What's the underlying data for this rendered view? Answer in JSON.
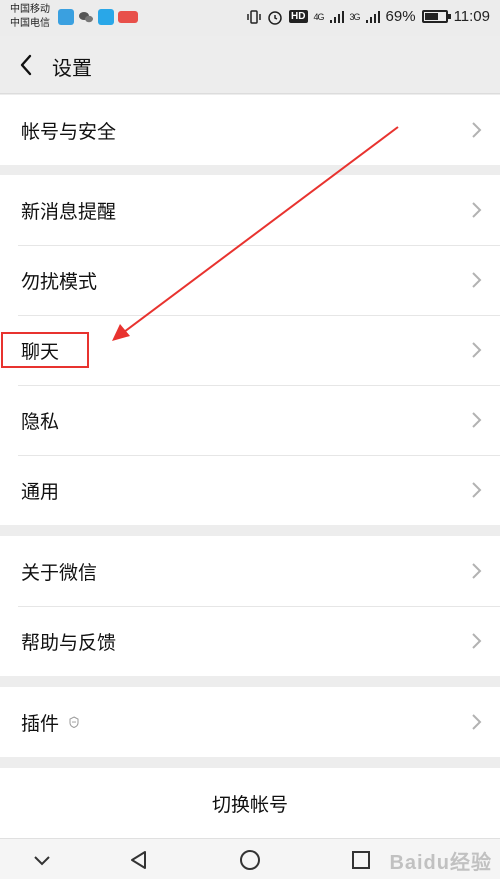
{
  "status_bar": {
    "carrier1": "中国移动",
    "carrier2": "中国电信",
    "net1": "4G",
    "net2": "3G",
    "battery_text": "69%",
    "battery_level": 0.69,
    "time": "11:09",
    "hd": "HD"
  },
  "header": {
    "title": "设置"
  },
  "groups": [
    {
      "items": [
        {
          "label": "帐号与安全"
        }
      ]
    },
    {
      "items": [
        {
          "label": "新消息提醒"
        },
        {
          "label": "勿扰模式"
        },
        {
          "label": "聊天"
        },
        {
          "label": "隐私"
        },
        {
          "label": "通用"
        }
      ]
    },
    {
      "items": [
        {
          "label": "关于微信"
        },
        {
          "label": "帮助与反馈"
        }
      ]
    },
    {
      "items": [
        {
          "label": "插件"
        }
      ]
    }
  ],
  "switch_account": {
    "label": "切换帐号"
  },
  "watermark": {
    "text": "Baidu经验"
  },
  "colors": {
    "annotation": "#e8332f",
    "background": "#ededed",
    "row_bg": "#ffffff"
  }
}
